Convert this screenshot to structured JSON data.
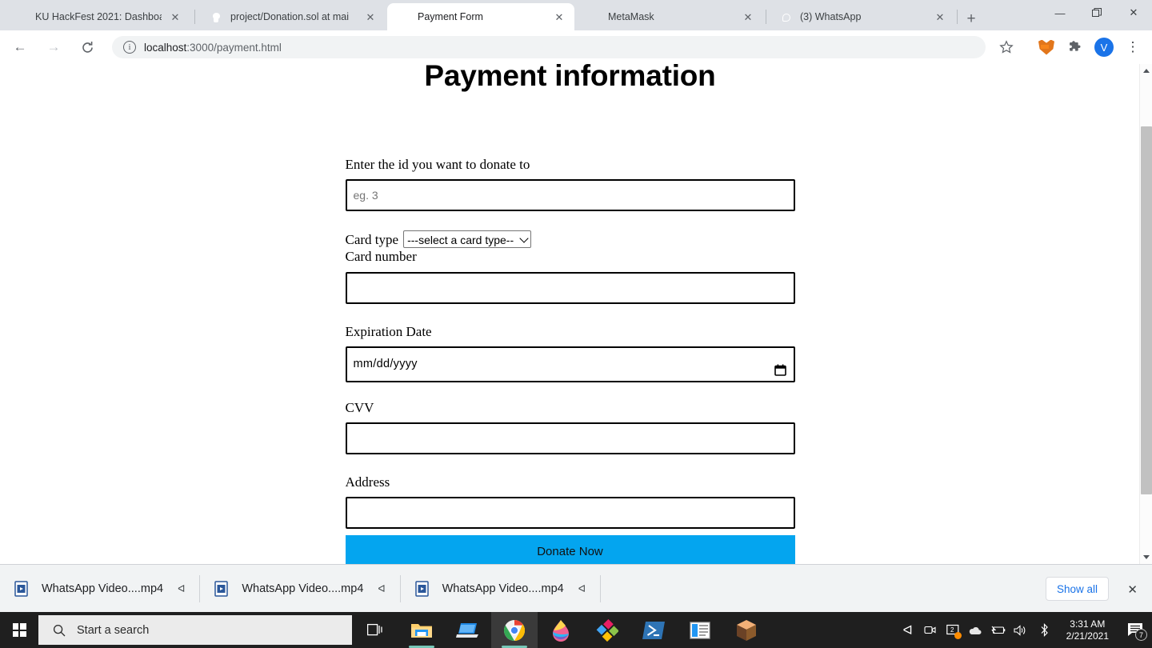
{
  "browser": {
    "tabs": [
      {
        "title": "KU HackFest 2021: Dashboa",
        "favicon": "blue-doc-icon",
        "active": false
      },
      {
        "title": "project/Donation.sol at mai",
        "favicon": "github-icon",
        "active": false
      },
      {
        "title": "Payment Form",
        "favicon": "globe-icon",
        "active": true
      },
      {
        "title": "MetaMask",
        "favicon": "metamask-fox-icon",
        "active": false
      },
      {
        "title": "(3) WhatsApp",
        "favicon": "whatsapp-icon",
        "active": false
      }
    ],
    "new_tab_label": "+",
    "window_controls": {
      "minimize": "—",
      "maximize": "❐",
      "close": "✕"
    },
    "toolbar": {
      "back": "←",
      "forward": "→",
      "reload": "↻",
      "info_icon": "i",
      "url_host": "localhost",
      "url_path": ":3000/payment.html",
      "bookmark_star": "☆",
      "extension_metamask": "metamask-fox-icon",
      "extensions_puzzle": "puzzle-icon",
      "profile_initial": "V",
      "menu": "⋮"
    },
    "scrollbar": {
      "up_arrow": "▲",
      "down_arrow": "▼"
    }
  },
  "page": {
    "title": "Payment information",
    "fields": {
      "donate_id": {
        "label": "Enter the id you want to donate to",
        "placeholder": "eg. 3",
        "value": ""
      },
      "card_type": {
        "label": "Card type",
        "selected": "---select a card type--"
      },
      "card_number": {
        "label": "Card number",
        "value": ""
      },
      "expiration_date": {
        "label": "Expiration Date",
        "value": "mm/dd/yyyy"
      },
      "cvv": {
        "label": "CVV",
        "value": ""
      },
      "address": {
        "label": "Address",
        "value": ""
      }
    },
    "submit_label": "Donate Now",
    "accent_color": "#04A5EF"
  },
  "downloads": {
    "items": [
      {
        "name": "WhatsApp Video....mp4",
        "icon": "video-file-icon",
        "chevron": "ⱏ"
      },
      {
        "name": "WhatsApp Video....mp4",
        "icon": "video-file-icon",
        "chevron": "ⱏ"
      },
      {
        "name": "WhatsApp Video....mp4",
        "icon": "video-file-icon",
        "chevron": "ⱏ"
      }
    ],
    "show_all_label": "Show all",
    "close_label": "✕"
  },
  "taskbar": {
    "start_label": "windows-logo",
    "search_placeholder": "Start a search",
    "task_view": "task-view-icon",
    "apps": [
      {
        "name": "file-explorer",
        "active": false
      },
      {
        "name": "remote-desktop",
        "active": false
      },
      {
        "name": "google-chrome",
        "active": true
      },
      {
        "name": "drupal-teardrop",
        "active": false
      },
      {
        "name": "colorful-diamond-app",
        "active": false
      },
      {
        "name": "powershell",
        "active": false
      },
      {
        "name": "windows-app",
        "active": false
      },
      {
        "name": "ganache-cube",
        "active": false
      }
    ],
    "tray": {
      "chevron_up": "ⱏ",
      "icons": [
        "camera-icon",
        "screen-share-icon",
        "onedrive-icon",
        "battery-icon",
        "volume-icon",
        "bluetooth-icon"
      ],
      "time": "3:31 AM",
      "date": "2/21/2021",
      "notification_count": "7"
    }
  }
}
